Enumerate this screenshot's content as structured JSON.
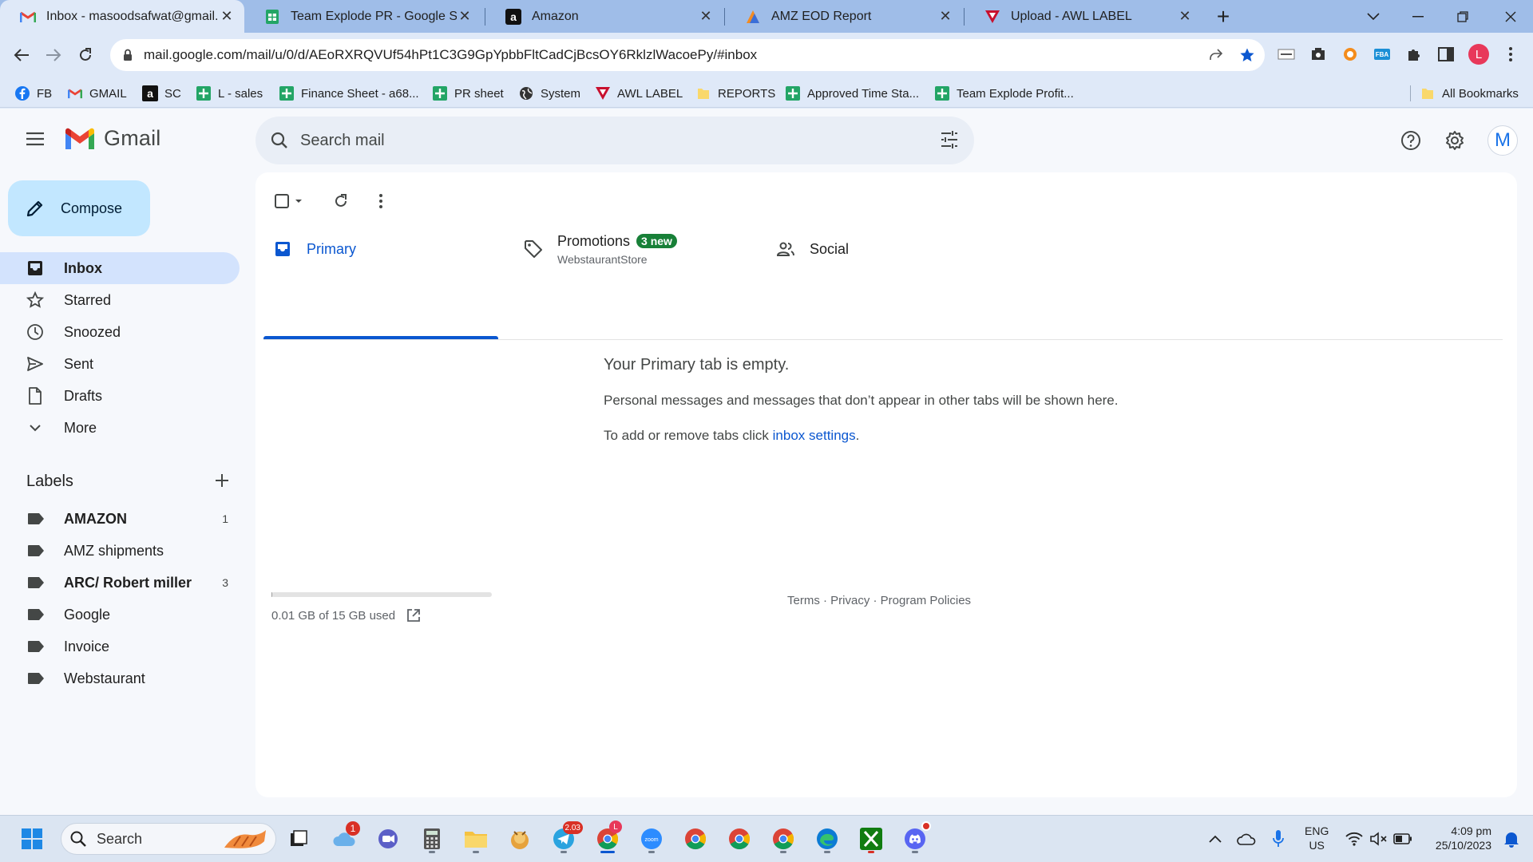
{
  "browser": {
    "tabs": [
      {
        "title": "Inbox - masoodsafwat@gmail.com",
        "icon": "gmail-icon"
      },
      {
        "title": "Team Explode PR - Google Sheets",
        "icon": "sheets-icon"
      },
      {
        "title": "Amazon",
        "icon": "amazon-icon"
      },
      {
        "title": "AMZ EOD Report",
        "icon": "report-icon"
      },
      {
        "title": "Upload - AWL LABEL",
        "icon": "awl-icon"
      }
    ],
    "url": "mail.google.com/mail/u/0/d/AEoRXRQVUf54hPt1C3G9GpYpbbFltCadCjBcsOY6RklzlWacoePy/#inbox",
    "profile_initial": "L",
    "bookmarks": [
      {
        "label": "FB",
        "icon": "facebook-icon"
      },
      {
        "label": "GMAIL",
        "icon": "gmail-icon"
      },
      {
        "label": "SC",
        "icon": "amazon-icon"
      },
      {
        "label": "L - sales",
        "icon": "sheets-icon"
      },
      {
        "label": "Finance Sheet - a68...",
        "icon": "sheets-icon"
      },
      {
        "label": "PR sheet",
        "icon": "sheets-icon"
      },
      {
        "label": "System",
        "icon": "globe-icon"
      },
      {
        "label": "AWL LABEL",
        "icon": "awl-icon"
      },
      {
        "label": "REPORTS",
        "icon": "folder-icon"
      },
      {
        "label": "Approved Time Sta...",
        "icon": "sheets-icon"
      },
      {
        "label": "Team Explode Profit...",
        "icon": "sheets-icon"
      }
    ],
    "all_bookmarks": "All Bookmarks"
  },
  "gmail": {
    "brand": "Gmail",
    "search_placeholder": "Search mail",
    "account_initial": "M",
    "compose": "Compose",
    "nav": [
      {
        "label": "Inbox",
        "icon": "inbox-icon",
        "active": true
      },
      {
        "label": "Starred",
        "icon": "star-icon"
      },
      {
        "label": "Snoozed",
        "icon": "clock-icon"
      },
      {
        "label": "Sent",
        "icon": "send-icon"
      },
      {
        "label": "Drafts",
        "icon": "draft-icon"
      },
      {
        "label": "More",
        "icon": "chevron-down-icon"
      }
    ],
    "labels_title": "Labels",
    "labels": [
      {
        "label": "AMAZON",
        "count": "1",
        "bold": true
      },
      {
        "label": "AMZ shipments",
        "count": ""
      },
      {
        "label": "ARC/ Robert miller",
        "count": "3",
        "bold": true
      },
      {
        "label": "Google",
        "count": ""
      },
      {
        "label": "Invoice",
        "count": ""
      },
      {
        "label": "Webstaurant",
        "count": ""
      }
    ],
    "category_tabs": {
      "primary": "Primary",
      "promotions": "Promotions",
      "promotions_badge": "3 new",
      "promotions_sender": "WebstaurantStore",
      "social": "Social"
    },
    "empty": {
      "title": "Your Primary tab is empty.",
      "line1": "Personal messages and messages that don’t appear in other tabs will be shown here.",
      "line2_prefix": "To add or remove tabs click ",
      "line2_link": "inbox settings",
      "line2_suffix": "."
    },
    "storage": {
      "text": "0.01 GB of 15 GB used",
      "used_fraction": 0.001
    },
    "footer": "Terms · Privacy · Program Policies"
  },
  "taskbar": {
    "search": "Search",
    "lang_top": "ENG",
    "lang_bottom": "US",
    "time": "4:09 pm",
    "date": "25/10/2023"
  },
  "colors": {
    "accent": "#0b57d0",
    "compose_bg": "#c2e7ff",
    "active_nav": "#d3e3fd",
    "badge_green": "#188038"
  }
}
